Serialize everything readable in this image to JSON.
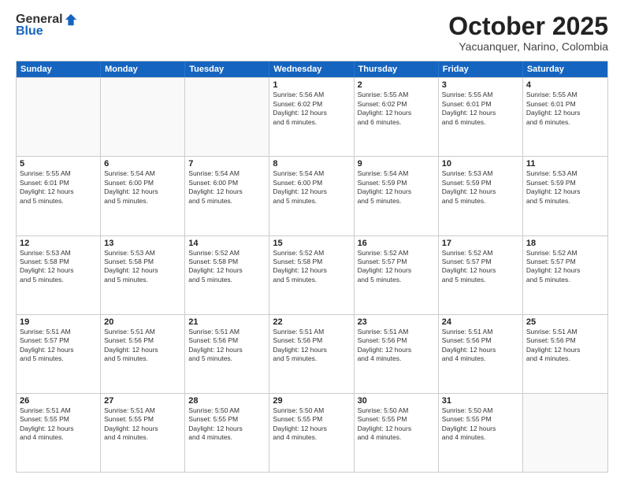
{
  "header": {
    "logo_general": "General",
    "logo_blue": "Blue",
    "month_title": "October 2025",
    "location": "Yacuanquer, Narino, Colombia"
  },
  "calendar": {
    "days_of_week": [
      "Sunday",
      "Monday",
      "Tuesday",
      "Wednesday",
      "Thursday",
      "Friday",
      "Saturday"
    ],
    "rows": [
      [
        {
          "day": "",
          "text": ""
        },
        {
          "day": "",
          "text": ""
        },
        {
          "day": "",
          "text": ""
        },
        {
          "day": "1",
          "text": "Sunrise: 5:56 AM\nSunset: 6:02 PM\nDaylight: 12 hours\nand 6 minutes."
        },
        {
          "day": "2",
          "text": "Sunrise: 5:55 AM\nSunset: 6:02 PM\nDaylight: 12 hours\nand 6 minutes."
        },
        {
          "day": "3",
          "text": "Sunrise: 5:55 AM\nSunset: 6:01 PM\nDaylight: 12 hours\nand 6 minutes."
        },
        {
          "day": "4",
          "text": "Sunrise: 5:55 AM\nSunset: 6:01 PM\nDaylight: 12 hours\nand 6 minutes."
        }
      ],
      [
        {
          "day": "5",
          "text": "Sunrise: 5:55 AM\nSunset: 6:01 PM\nDaylight: 12 hours\nand 5 minutes."
        },
        {
          "day": "6",
          "text": "Sunrise: 5:54 AM\nSunset: 6:00 PM\nDaylight: 12 hours\nand 5 minutes."
        },
        {
          "day": "7",
          "text": "Sunrise: 5:54 AM\nSunset: 6:00 PM\nDaylight: 12 hours\nand 5 minutes."
        },
        {
          "day": "8",
          "text": "Sunrise: 5:54 AM\nSunset: 6:00 PM\nDaylight: 12 hours\nand 5 minutes."
        },
        {
          "day": "9",
          "text": "Sunrise: 5:54 AM\nSunset: 5:59 PM\nDaylight: 12 hours\nand 5 minutes."
        },
        {
          "day": "10",
          "text": "Sunrise: 5:53 AM\nSunset: 5:59 PM\nDaylight: 12 hours\nand 5 minutes."
        },
        {
          "day": "11",
          "text": "Sunrise: 5:53 AM\nSunset: 5:59 PM\nDaylight: 12 hours\nand 5 minutes."
        }
      ],
      [
        {
          "day": "12",
          "text": "Sunrise: 5:53 AM\nSunset: 5:58 PM\nDaylight: 12 hours\nand 5 minutes."
        },
        {
          "day": "13",
          "text": "Sunrise: 5:53 AM\nSunset: 5:58 PM\nDaylight: 12 hours\nand 5 minutes."
        },
        {
          "day": "14",
          "text": "Sunrise: 5:52 AM\nSunset: 5:58 PM\nDaylight: 12 hours\nand 5 minutes."
        },
        {
          "day": "15",
          "text": "Sunrise: 5:52 AM\nSunset: 5:58 PM\nDaylight: 12 hours\nand 5 minutes."
        },
        {
          "day": "16",
          "text": "Sunrise: 5:52 AM\nSunset: 5:57 PM\nDaylight: 12 hours\nand 5 minutes."
        },
        {
          "day": "17",
          "text": "Sunrise: 5:52 AM\nSunset: 5:57 PM\nDaylight: 12 hours\nand 5 minutes."
        },
        {
          "day": "18",
          "text": "Sunrise: 5:52 AM\nSunset: 5:57 PM\nDaylight: 12 hours\nand 5 minutes."
        }
      ],
      [
        {
          "day": "19",
          "text": "Sunrise: 5:51 AM\nSunset: 5:57 PM\nDaylight: 12 hours\nand 5 minutes."
        },
        {
          "day": "20",
          "text": "Sunrise: 5:51 AM\nSunset: 5:56 PM\nDaylight: 12 hours\nand 5 minutes."
        },
        {
          "day": "21",
          "text": "Sunrise: 5:51 AM\nSunset: 5:56 PM\nDaylight: 12 hours\nand 5 minutes."
        },
        {
          "day": "22",
          "text": "Sunrise: 5:51 AM\nSunset: 5:56 PM\nDaylight: 12 hours\nand 5 minutes."
        },
        {
          "day": "23",
          "text": "Sunrise: 5:51 AM\nSunset: 5:56 PM\nDaylight: 12 hours\nand 4 minutes."
        },
        {
          "day": "24",
          "text": "Sunrise: 5:51 AM\nSunset: 5:56 PM\nDaylight: 12 hours\nand 4 minutes."
        },
        {
          "day": "25",
          "text": "Sunrise: 5:51 AM\nSunset: 5:56 PM\nDaylight: 12 hours\nand 4 minutes."
        }
      ],
      [
        {
          "day": "26",
          "text": "Sunrise: 5:51 AM\nSunset: 5:55 PM\nDaylight: 12 hours\nand 4 minutes."
        },
        {
          "day": "27",
          "text": "Sunrise: 5:51 AM\nSunset: 5:55 PM\nDaylight: 12 hours\nand 4 minutes."
        },
        {
          "day": "28",
          "text": "Sunrise: 5:50 AM\nSunset: 5:55 PM\nDaylight: 12 hours\nand 4 minutes."
        },
        {
          "day": "29",
          "text": "Sunrise: 5:50 AM\nSunset: 5:55 PM\nDaylight: 12 hours\nand 4 minutes."
        },
        {
          "day": "30",
          "text": "Sunrise: 5:50 AM\nSunset: 5:55 PM\nDaylight: 12 hours\nand 4 minutes."
        },
        {
          "day": "31",
          "text": "Sunrise: 5:50 AM\nSunset: 5:55 PM\nDaylight: 12 hours\nand 4 minutes."
        },
        {
          "day": "",
          "text": ""
        }
      ]
    ]
  }
}
